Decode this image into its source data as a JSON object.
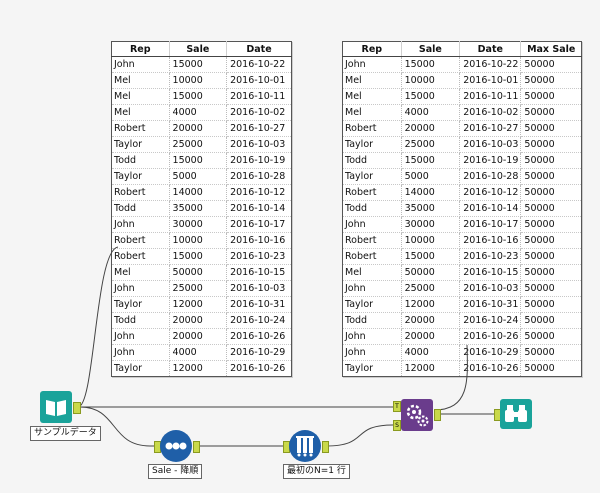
{
  "left_table": {
    "headers": [
      "Rep",
      "Sale",
      "Date"
    ],
    "rows": [
      [
        "John",
        "15000",
        "2016-10-22"
      ],
      [
        "Mel",
        "10000",
        "2016-10-01"
      ],
      [
        "Mel",
        "15000",
        "2016-10-11"
      ],
      [
        "Mel",
        "4000",
        "2016-10-02"
      ],
      [
        "Robert",
        "20000",
        "2016-10-27"
      ],
      [
        "Taylor",
        "25000",
        "2016-10-03"
      ],
      [
        "Todd",
        "15000",
        "2016-10-19"
      ],
      [
        "Taylor",
        "5000",
        "2016-10-28"
      ],
      [
        "Robert",
        "14000",
        "2016-10-12"
      ],
      [
        "Todd",
        "35000",
        "2016-10-14"
      ],
      [
        "John",
        "30000",
        "2016-10-17"
      ],
      [
        "Robert",
        "10000",
        "2016-10-16"
      ],
      [
        "Robert",
        "15000",
        "2016-10-23"
      ],
      [
        "Mel",
        "50000",
        "2016-10-15"
      ],
      [
        "John",
        "25000",
        "2016-10-03"
      ],
      [
        "Taylor",
        "12000",
        "2016-10-31"
      ],
      [
        "Todd",
        "20000",
        "2016-10-24"
      ],
      [
        "John",
        "20000",
        "2016-10-26"
      ],
      [
        "John",
        "4000",
        "2016-10-29"
      ],
      [
        "Taylor",
        "12000",
        "2016-10-26"
      ]
    ]
  },
  "right_table": {
    "headers": [
      "Rep",
      "Sale",
      "Date",
      "Max Sale"
    ],
    "rows": [
      [
        "John",
        "15000",
        "2016-10-22",
        "50000"
      ],
      [
        "Mel",
        "10000",
        "2016-10-01",
        "50000"
      ],
      [
        "Mel",
        "15000",
        "2016-10-11",
        "50000"
      ],
      [
        "Mel",
        "4000",
        "2016-10-02",
        "50000"
      ],
      [
        "Robert",
        "20000",
        "2016-10-27",
        "50000"
      ],
      [
        "Taylor",
        "25000",
        "2016-10-03",
        "50000"
      ],
      [
        "Todd",
        "15000",
        "2016-10-19",
        "50000"
      ],
      [
        "Taylor",
        "5000",
        "2016-10-28",
        "50000"
      ],
      [
        "Robert",
        "14000",
        "2016-10-12",
        "50000"
      ],
      [
        "Todd",
        "35000",
        "2016-10-14",
        "50000"
      ],
      [
        "John",
        "30000",
        "2016-10-17",
        "50000"
      ],
      [
        "Robert",
        "10000",
        "2016-10-16",
        "50000"
      ],
      [
        "Robert",
        "15000",
        "2016-10-23",
        "50000"
      ],
      [
        "Mel",
        "50000",
        "2016-10-15",
        "50000"
      ],
      [
        "John",
        "25000",
        "2016-10-03",
        "50000"
      ],
      [
        "Taylor",
        "12000",
        "2016-10-31",
        "50000"
      ],
      [
        "Todd",
        "20000",
        "2016-10-24",
        "50000"
      ],
      [
        "John",
        "20000",
        "2016-10-26",
        "50000"
      ],
      [
        "John",
        "4000",
        "2016-10-29",
        "50000"
      ],
      [
        "Taylor",
        "12000",
        "2016-10-26",
        "50000"
      ]
    ]
  },
  "tools": {
    "input_label": "サンプルデータ",
    "sort_label": "Sale - 降順",
    "sample_label": "最初のN=1 行",
    "append_port_target": "T",
    "append_port_source": "S"
  },
  "icons": {
    "input": "book-icon",
    "sort": "sort-icon",
    "sample": "sample-icon",
    "append": "append-fields-icon",
    "browse": "binoculars-icon"
  },
  "colors": {
    "input_tool": "#1aa39a",
    "sort_tool": "#1f5fa8",
    "sample_tool": "#1f5fa8",
    "append_tool": "#6a3c8c",
    "browse_tool": "#1aa39a",
    "connector": "#c9d94a"
  }
}
